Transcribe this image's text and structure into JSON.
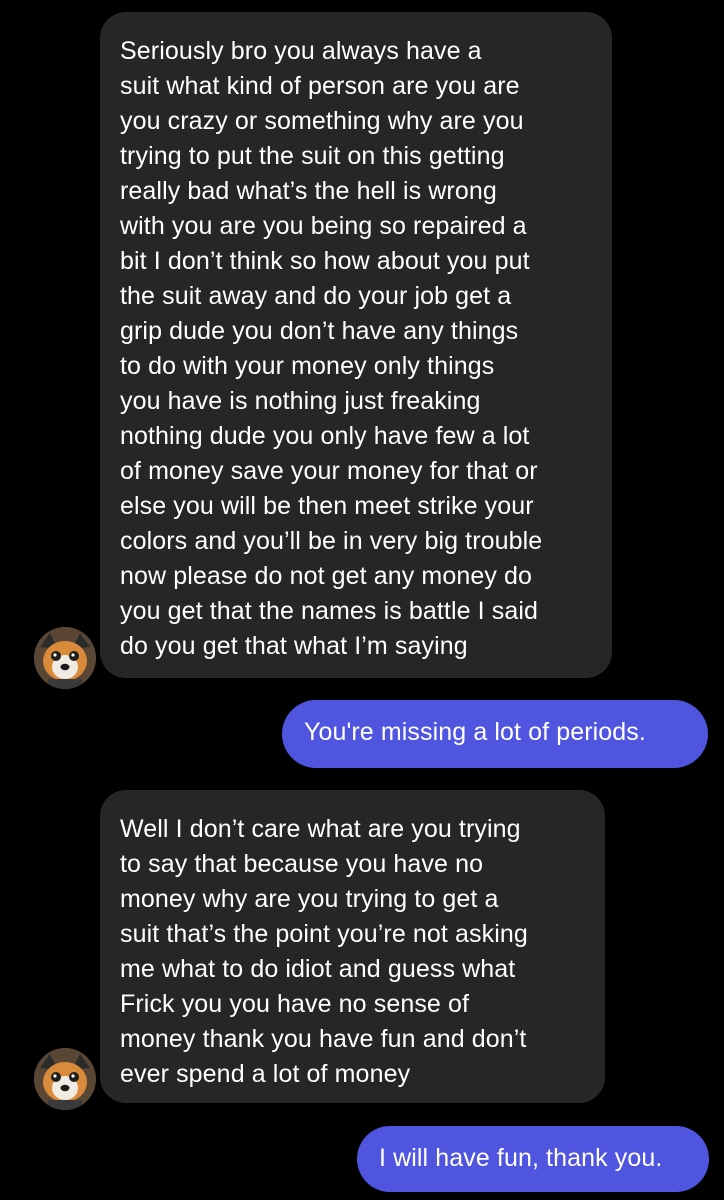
{
  "colors": {
    "background": "#000000",
    "incoming_bubble": "#262626",
    "outgoing_bubble": "#4f55de",
    "text": "#ffffff"
  },
  "avatar": {
    "icon": "dog-avatar-icon"
  },
  "messages": [
    {
      "direction": "incoming",
      "lines": [
        "Seriously bro you always have a",
        "suit what kind of person are you are",
        "you crazy or something why are you",
        "trying to put the suit on this getting",
        "really bad what’s the hell is wrong",
        "with you are you being so repaired a",
        "bit I don’t think so how about you put",
        "the suit away and do your job get a",
        "grip dude you don’t have any things",
        "to do with your money only things",
        "you have is nothing just freaking",
        "nothing dude you only have few a lot",
        "of money save your money for that or",
        "else you will be then meet strike your",
        "colors and you’ll be in very big trouble",
        "now please do not get any money do",
        "you get that the names is battle I said",
        "do you get that what I’m saying"
      ]
    },
    {
      "direction": "outgoing",
      "lines": [
        "You're missing a lot of periods."
      ]
    },
    {
      "direction": "incoming",
      "lines": [
        "Well I don’t care what are you trying",
        "to say that because you have no",
        "money why are you trying to get a",
        "suit that’s the point you’re not asking",
        "me what to do idiot and guess what",
        "Frick you you have no sense of",
        "money thank you have fun and don’t",
        "ever spend a lot of money"
      ]
    },
    {
      "direction": "outgoing",
      "lines": [
        "I will have fun, thank you."
      ]
    }
  ]
}
